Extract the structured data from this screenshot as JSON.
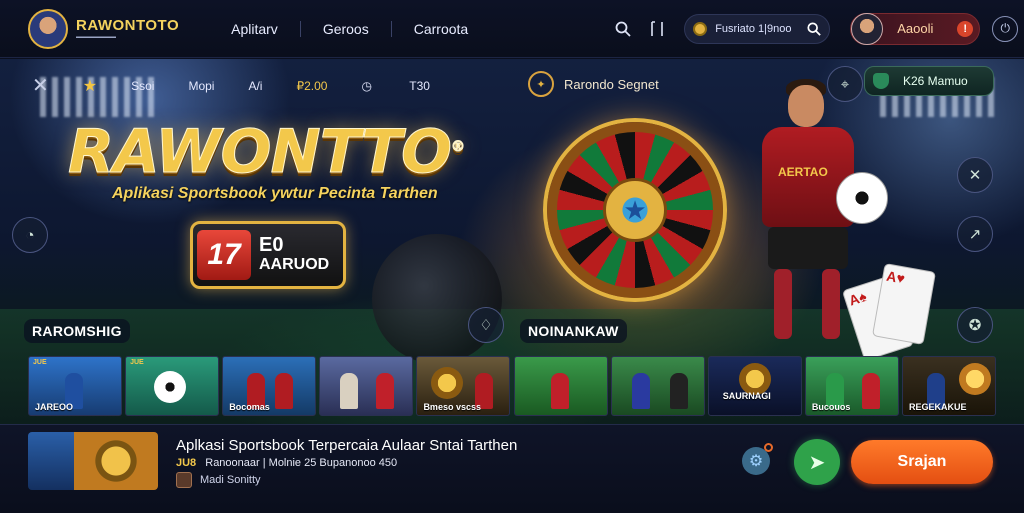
{
  "header": {
    "brand": "RAWONTOTO",
    "brand_small": "▬▬▬▬▬▬▬▬",
    "nav": [
      "Aplitarv",
      "Geroos",
      "Carroota"
    ],
    "icons": [
      "search-icon",
      "bookmark-icon"
    ],
    "search_pill_text": "Fusriato 1|9noo",
    "user_name": "Aaooli",
    "alert_count": "!"
  },
  "hero": {
    "hud": {
      "item1": "Ssoi",
      "item2": "Mopi",
      "item3": "A/i",
      "item4": "₽2.00",
      "item5": "T30"
    },
    "brand_big": "RAWONTTO",
    "brand_registered": "®",
    "subtitle": "Aplikasi Sportsbook ywtur Pecinta Tarthen",
    "promo_num": "17",
    "promo_line1": "E0",
    "promo_line2": "AARUOD",
    "wheel_title": "Rarondo Segnet",
    "green_pill_text": "K26 Mamuo",
    "player_shirt": "AERTAO",
    "section_left": "RAROMSHIG",
    "section_right": "NOINANKAW",
    "thumbs": [
      {
        "tag": "JUE",
        "cap": "JAREOO"
      },
      {
        "tag": "JUE",
        "cap": ""
      },
      {
        "tag": "",
        "cap": "Bocomas"
      },
      {
        "tag": "",
        "cap": ""
      },
      {
        "tag": "",
        "cap": "Bmeso vscss"
      },
      {
        "tag": "",
        "cap": ""
      },
      {
        "tag": "",
        "cap": ""
      },
      {
        "tag": "",
        "cap": "SAURNAGI"
      },
      {
        "tag": "",
        "cap": "Bucouos"
      },
      {
        "tag": "",
        "cap": "REGEKAKUE"
      }
    ]
  },
  "bottom": {
    "title": "Aplkasi Sportsbook Terpercaia Aulaar Sntai Tarthen",
    "meta_tag": "JU8",
    "meta_text": "Ranoonaar | Molnie 25 Bupanonoo 450",
    "sub_text": "Madi Sonitty",
    "cta": "Srajan"
  },
  "colors": {
    "accent_gold": "#f3c84b",
    "cta_orange": "#ff7a2a",
    "go_green": "#2fa24a",
    "bg": "#0b0f1e"
  }
}
